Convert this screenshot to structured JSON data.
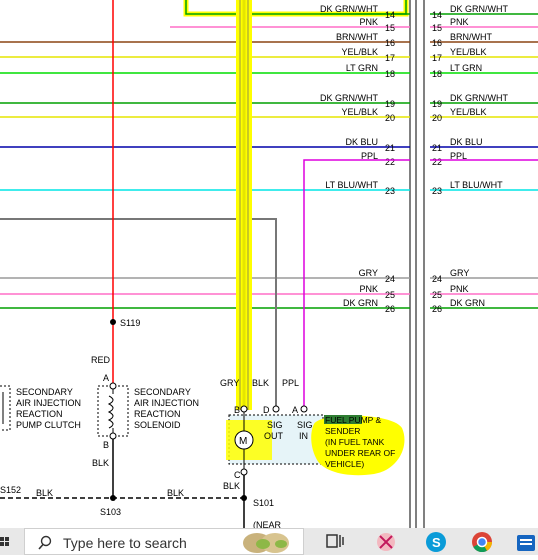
{
  "wires": [
    {
      "pin": "14",
      "name": "DK GRN/WHT",
      "color": "#00a000"
    },
    {
      "pin": "15",
      "name": "PNK",
      "color": "#ff6ec7"
    },
    {
      "pin": "16",
      "name": "BRN/WHT",
      "color": "#8b4513"
    },
    {
      "pin": "17",
      "name": "YEL/BLK",
      "color": "#e6e600"
    },
    {
      "pin": "18",
      "name": "LT GRN",
      "color": "#00dd00"
    },
    {
      "pin": "19",
      "name": "DK GRN/WHT",
      "color": "#00a000"
    },
    {
      "pin": "20",
      "name": "YEL/BLK",
      "color": "#e6e600"
    },
    {
      "pin": "21",
      "name": "DK BLU",
      "color": "#0000aa"
    },
    {
      "pin": "22",
      "name": "PPL",
      "color": "#dd00dd"
    },
    {
      "pin": "23",
      "name": "LT BLU/WHT",
      "color": "#00e5e5"
    },
    {
      "pin": "24",
      "name": "GRY",
      "color": "#9a9a9a"
    },
    {
      "pin": "25",
      "name": "PNK",
      "color": "#ff6ec7"
    },
    {
      "pin": "26",
      "name": "DK GRN",
      "color": "#00a000"
    }
  ],
  "splices": {
    "s119": "S119",
    "s103": "S103",
    "s101": "S101",
    "s152": "S152"
  },
  "wire_labels": {
    "red": "RED",
    "blk_a": "BLK",
    "blk_b": "BLK",
    "blk_c": "BLK",
    "blk_d": "BLK",
    "gry": "GRY",
    "blk_pump": "BLK",
    "ppl": "PPL"
  },
  "pins": {
    "a": "A",
    "b": "B",
    "c": "C",
    "d": "D"
  },
  "components": {
    "pump_clutch": [
      "SECONDARY",
      "AIR INJECTION",
      "REACTION",
      "PUMP CLUTCH"
    ],
    "solenoid": [
      "SECONDARY",
      "AIR INJECTION",
      "REACTION",
      "SOLENOID"
    ],
    "fuel_pump": [
      "FUEL PUMP &",
      "SENDER",
      "(IN FUEL TANK",
      "UNDER REAR OF",
      "VEHICLE)"
    ],
    "sig_out": [
      "SIG",
      "OUT"
    ],
    "sig_in": [
      "SIG",
      "IN"
    ],
    "motor": "M",
    "near": "(NEAR"
  },
  "taskbar": {
    "search_placeholder": "Type here to search"
  },
  "colors": {
    "highlight": "#ffff00",
    "red_wire": "#ff0000",
    "grey_wire": "#777777",
    "black_wire": "#000000"
  }
}
